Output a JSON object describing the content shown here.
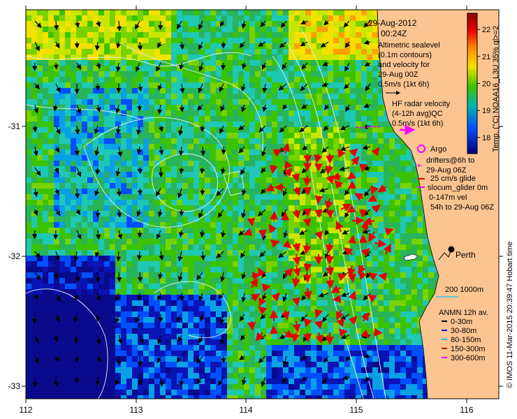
{
  "header": {
    "date": "29-Aug-2012",
    "time": "00:24Z"
  },
  "altimetry": {
    "lines": [
      "Altimetric sealevel",
      "(0.1m contours)",
      "and velocity for",
      "29-Aug 00Z",
      "0.5m/s (1kt 6h)"
    ]
  },
  "hf_radar": {
    "lines": [
      "HF radar velocity",
      "(4-12h avg)QC",
      "0.5m/s (1kt 6h)"
    ]
  },
  "legend": {
    "argo": "Argo",
    "drifters": [
      "drifters@6h to",
      "29-Aug 06Z"
    ],
    "glider": [
      "25 cm/s glide",
      "slocum_glider 0m",
      "0-147m vel",
      "54h to 29-Aug 06Z"
    ],
    "isobaths": "200  1000m",
    "anmn_title": "ANMN 12h av.",
    "anmn_items": [
      {
        "label": "0-30m",
        "color": "#000000"
      },
      {
        "label": "30-80m",
        "color": "#0000ff"
      },
      {
        "label": "80-150m",
        "color": "#00c8ff"
      },
      {
        "label": "150-300m",
        "color": "#c80000"
      },
      {
        "label": "300-600m",
        "color": "#ff00ff"
      }
    ]
  },
  "place": {
    "perth": "Perth"
  },
  "colorbar": {
    "ticks": [
      "22",
      "21",
      "20",
      "19",
      "18"
    ],
    "label": "Temp. (°C) NOAA16_L3U 35% ql>=2",
    "range": [
      17.4,
      22.6
    ],
    "tick_values": [
      22,
      21,
      20,
      19,
      18
    ]
  },
  "credit": "© IMOS 11-Mar-2015 20:39:47 Hobart time",
  "axes": {
    "x_ticks": [
      "112",
      "113",
      "114",
      "115",
      "116"
    ],
    "y_ticks": [
      "-31",
      "-32",
      "-33"
    ],
    "lon_range": [
      112,
      116.3
    ],
    "lat_range": [
      -30.1,
      -33.1
    ]
  },
  "colors": {
    "land": "#fcc490",
    "radar_vector": "#e60000",
    "glider": "#ff00ff",
    "contour": "#e6f0ff"
  }
}
